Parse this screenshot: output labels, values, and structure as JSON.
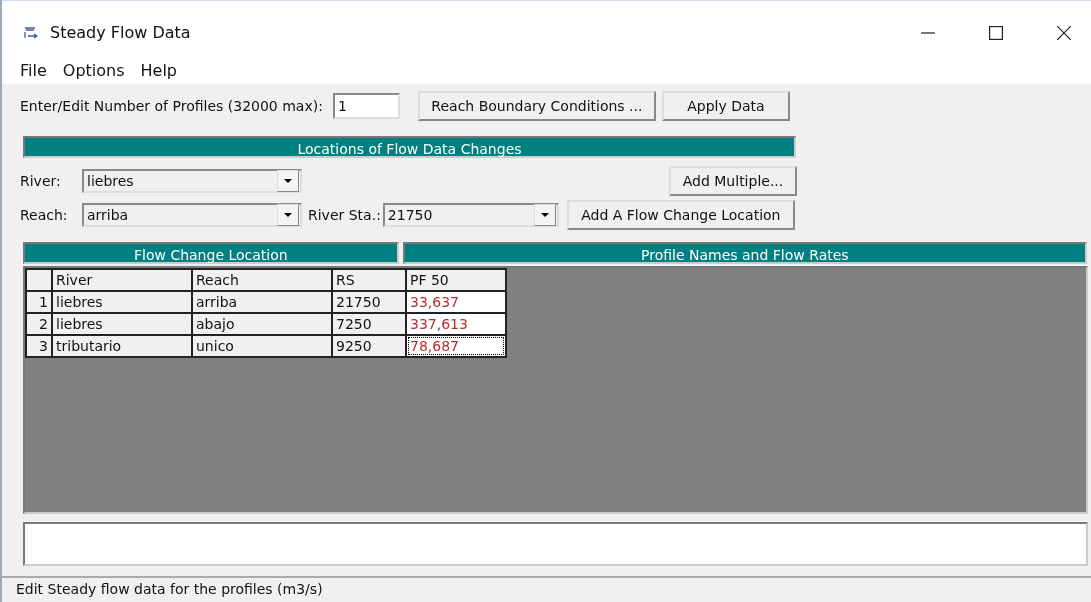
{
  "window": {
    "title": "Steady Flow Data"
  },
  "menu": [
    "File",
    "Options",
    "Help"
  ],
  "profiles": {
    "label": "Enter/Edit Number of Profiles (32000 max):",
    "value": "1"
  },
  "buttons_top": [
    "Reach Boundary Conditions ...",
    "Apply Data"
  ],
  "locations_header": "Locations of Flow Data Changes",
  "river": {
    "label": "River:",
    "value": "liebres"
  },
  "add_multiple": "Add Multiple...",
  "reach": {
    "label": "Reach:",
    "value": "arriba"
  },
  "river_sta": {
    "label": "River Sta.:",
    "value": "21750"
  },
  "add_location": "Add A Flow Change Location",
  "table": {
    "section_headers": [
      "Flow Change Location",
      "Profile Names and Flow Rates"
    ],
    "columns": [
      "River",
      "Reach",
      "RS",
      "PF 50"
    ],
    "rows": [
      {
        "number": "1",
        "cells": [
          "liebres",
          "arriba",
          "21750",
          "33,637"
        ],
        "selected": false
      },
      {
        "number": "2",
        "cells": [
          "liebres",
          "abajo",
          "7250",
          "337,613"
        ],
        "selected": false
      },
      {
        "number": "3",
        "cells": [
          "tributario",
          "unico",
          "9250",
          "78,687"
        ],
        "selected": true
      }
    ]
  },
  "status_bar": "Edit Steady flow data for the profiles (m3/s)"
}
